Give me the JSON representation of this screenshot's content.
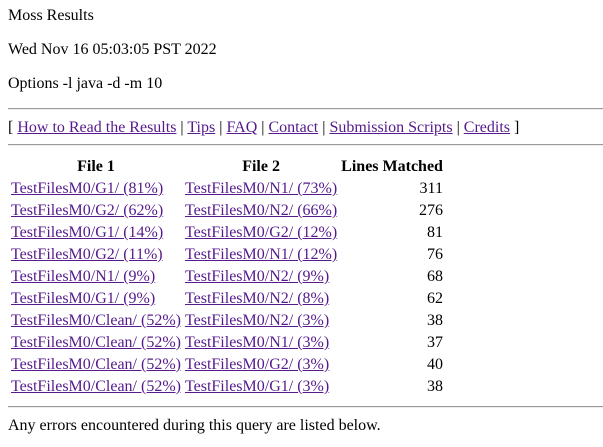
{
  "header": {
    "title": "Moss Results",
    "date": "Wed Nov 16 05:03:05 PST 2022",
    "options": "Options -l java -d -m 10"
  },
  "nav": {
    "open": "[",
    "close": "]",
    "sep": "|",
    "links": [
      "How to Read the Results",
      "Tips",
      "FAQ",
      "Contact",
      "Submission Scripts",
      "Credits"
    ]
  },
  "table": {
    "headers": [
      "File 1",
      "File 2",
      "Lines Matched"
    ],
    "rows": [
      {
        "file1": "TestFilesM0/G1/ (81%)",
        "file2": "TestFilesM0/N1/ (73%)",
        "lines": "311"
      },
      {
        "file1": "TestFilesM0/G2/ (62%)",
        "file2": "TestFilesM0/N2/ (66%)",
        "lines": "276"
      },
      {
        "file1": "TestFilesM0/G1/ (14%)",
        "file2": "TestFilesM0/G2/ (12%)",
        "lines": "81"
      },
      {
        "file1": "TestFilesM0/G2/ (11%)",
        "file2": "TestFilesM0/N1/ (12%)",
        "lines": "76"
      },
      {
        "file1": "TestFilesM0/N1/ (9%)",
        "file2": "TestFilesM0/N2/ (9%)",
        "lines": "68"
      },
      {
        "file1": "TestFilesM0/G1/ (9%)",
        "file2": "TestFilesM0/N2/ (8%)",
        "lines": "62"
      },
      {
        "file1": "TestFilesM0/Clean/ (52%)",
        "file2": "TestFilesM0/N2/ (3%)",
        "lines": "38"
      },
      {
        "file1": "TestFilesM0/Clean/ (52%)",
        "file2": "TestFilesM0/N1/ (3%)",
        "lines": "37"
      },
      {
        "file1": "TestFilesM0/Clean/ (52%)",
        "file2": "TestFilesM0/G2/ (3%)",
        "lines": "40"
      },
      {
        "file1": "TestFilesM0/Clean/ (52%)",
        "file2": "TestFilesM0/G1/ (3%)",
        "lines": "38"
      }
    ]
  },
  "footer": {
    "text": "Any errors encountered during this query are listed below."
  },
  "colors": {
    "link": "#551a8b",
    "rule": "#9a9a9a",
    "text": "#000000",
    "background": "#ffffff"
  }
}
